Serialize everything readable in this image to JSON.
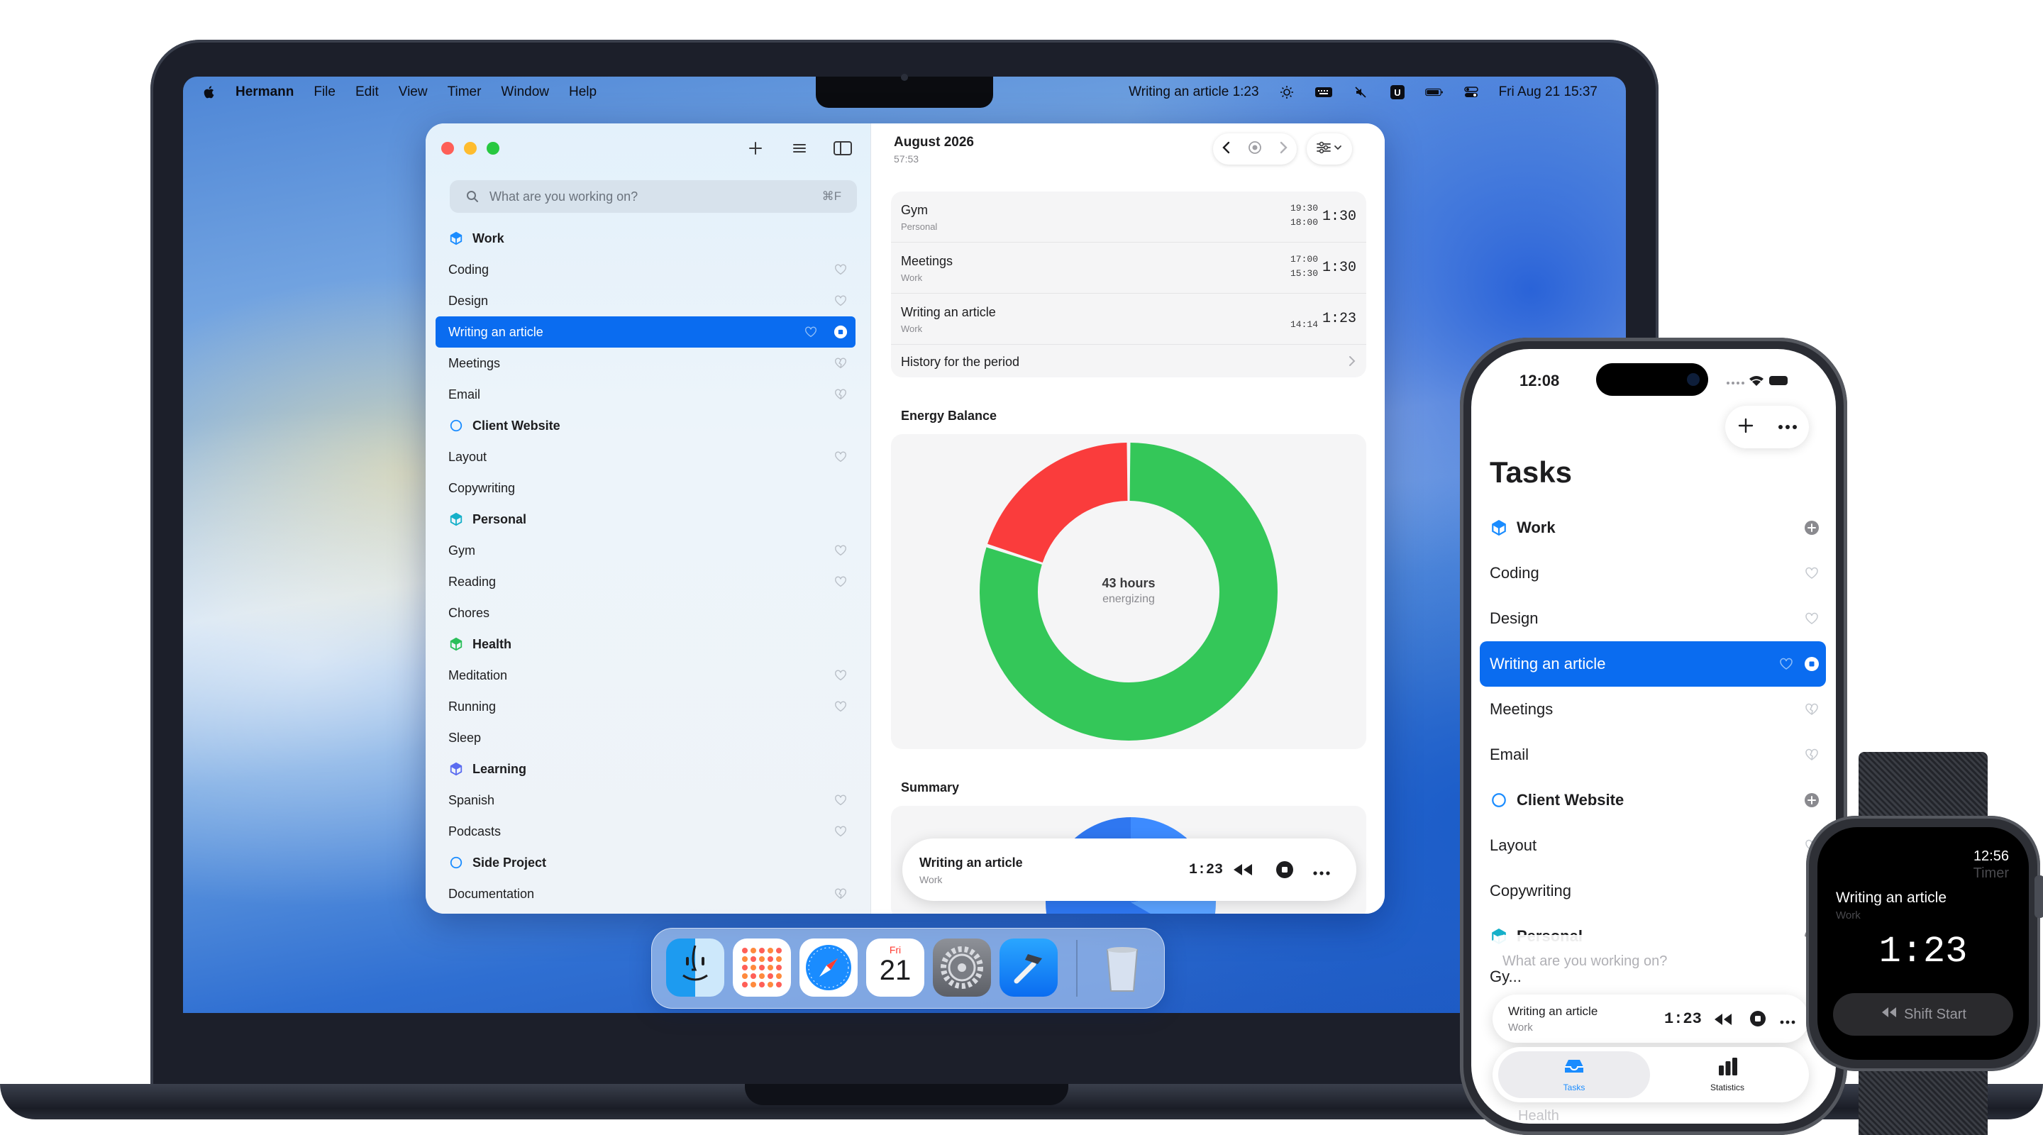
{
  "menubar": {
    "app_name": "Hermann",
    "items": [
      "File",
      "Edit",
      "View",
      "Timer",
      "Window",
      "Help"
    ],
    "timer_status": "Writing an article 1:23",
    "datetime": "Fri Aug 21  15:37"
  },
  "sidebar": {
    "search_placeholder": "What are you working on?",
    "search_shortcut": "⌘F",
    "rows": [
      {
        "label": "Work",
        "type": "group",
        "icon": "cube-icon",
        "icon_color": "#1a8cff"
      },
      {
        "label": "Coding",
        "type": "task",
        "action": "heart-icon"
      },
      {
        "label": "Design",
        "type": "task",
        "action": "heart-icon"
      },
      {
        "label": "Writing an article",
        "type": "task",
        "selected": true,
        "action": "heart-icon"
      },
      {
        "label": "Meetings",
        "type": "task",
        "action": "heart-broken-icon"
      },
      {
        "label": "Email",
        "type": "task",
        "action": "heart-broken-icon"
      },
      {
        "label": "Client Website",
        "type": "group",
        "icon": "circle-icon",
        "icon_color": "#1a8cff"
      },
      {
        "label": "Layout",
        "type": "task",
        "action": "heart-icon"
      },
      {
        "label": "Copywriting",
        "type": "task"
      },
      {
        "label": "Personal",
        "type": "group",
        "icon": "cube-icon",
        "icon_color": "#16b0c9"
      },
      {
        "label": "Gym",
        "type": "task",
        "action": "heart-icon"
      },
      {
        "label": "Reading",
        "type": "task",
        "action": "heart-icon"
      },
      {
        "label": "Chores",
        "type": "task"
      },
      {
        "label": "Health",
        "type": "group",
        "icon": "cube-icon",
        "icon_color": "#2bbf5a"
      },
      {
        "label": "Meditation",
        "type": "task",
        "action": "heart-icon"
      },
      {
        "label": "Running",
        "type": "task",
        "action": "heart-icon"
      },
      {
        "label": "Sleep",
        "type": "task"
      },
      {
        "label": "Learning",
        "type": "group",
        "icon": "cube-icon",
        "icon_color": "#5b6cf0"
      },
      {
        "label": "Spanish",
        "type": "task",
        "action": "heart-icon"
      },
      {
        "label": "Podcasts",
        "type": "task",
        "action": "heart-icon"
      },
      {
        "label": "Side Project",
        "type": "group",
        "icon": "circle-icon",
        "icon_color": "#1a8cff"
      },
      {
        "label": "Documentation",
        "type": "task",
        "action": "heart-broken-icon"
      }
    ]
  },
  "main": {
    "period_title": "August 2026",
    "period_total": "57:53",
    "history": [
      {
        "name": "Gym",
        "category": "Personal",
        "end": "19:30",
        "start": "18:00",
        "duration": "1:30"
      },
      {
        "name": "Meetings",
        "category": "Work",
        "end": "17:00",
        "start": "15:30",
        "duration": "1:30"
      },
      {
        "name": "Writing an article",
        "category": "Work",
        "end": "",
        "start": "14:14",
        "duration": "1:23"
      }
    ],
    "history_link": "History for the period",
    "energy_title": "Energy Balance",
    "energy_center_value": "43 hours",
    "energy_center_label": "energizing",
    "summary_title": "Summary",
    "player": {
      "task": "Writing an article",
      "category": "Work",
      "time": "1:23"
    }
  },
  "chart_data": {
    "type": "pie",
    "title": "Energy Balance",
    "variant": "donut",
    "slices": [
      {
        "value": 0.8,
        "color": "#34c759"
      },
      {
        "value": 0.2,
        "color": "#fa3c3c"
      }
    ],
    "center_text": "43 hours energizing"
  },
  "dock": {
    "calendar_day": "Fri",
    "calendar_date": "21"
  },
  "phone": {
    "clock": "12:08",
    "title": "Tasks",
    "rows": [
      {
        "label": "Work",
        "type": "group",
        "icon": "cube-icon",
        "icon_color": "#1a8cff",
        "action": "plus-circle-icon"
      },
      {
        "label": "Coding",
        "type": "task",
        "action": "heart-icon"
      },
      {
        "label": "Design",
        "type": "task",
        "action": "heart-icon"
      },
      {
        "label": "Writing an article",
        "type": "task",
        "selected": true,
        "action": "stop-icon"
      },
      {
        "label": "Meetings",
        "type": "task",
        "action": "heart-broken-icon"
      },
      {
        "label": "Email",
        "type": "task",
        "action": "heart-broken-icon"
      },
      {
        "label": "Client Website",
        "type": "group",
        "icon": "circle-icon",
        "icon_color": "#1a8cff",
        "action": "plus-circle-icon"
      },
      {
        "label": "Layout",
        "type": "task",
        "action": "heart-icon"
      },
      {
        "label": "Copywriting",
        "type": "task"
      },
      {
        "label": "Personal",
        "type": "group",
        "icon": "cube-icon",
        "icon_color": "#16b0c9",
        "action": "plus-circle-icon"
      }
    ],
    "search_placeholder": "What are you working on?",
    "player": {
      "task": "Writing an article",
      "category": "Work",
      "time": "1:23"
    },
    "tabs": [
      {
        "label": "Tasks",
        "active": true
      },
      {
        "label": "Statistics",
        "active": false
      }
    ],
    "peek_text": "Gy...",
    "peek_bottom": "Health"
  },
  "watch": {
    "clock": "12:56",
    "mode": "Timer",
    "task": "Writing an article",
    "category": "Work",
    "time": "1:23",
    "button": "Shift Start"
  }
}
